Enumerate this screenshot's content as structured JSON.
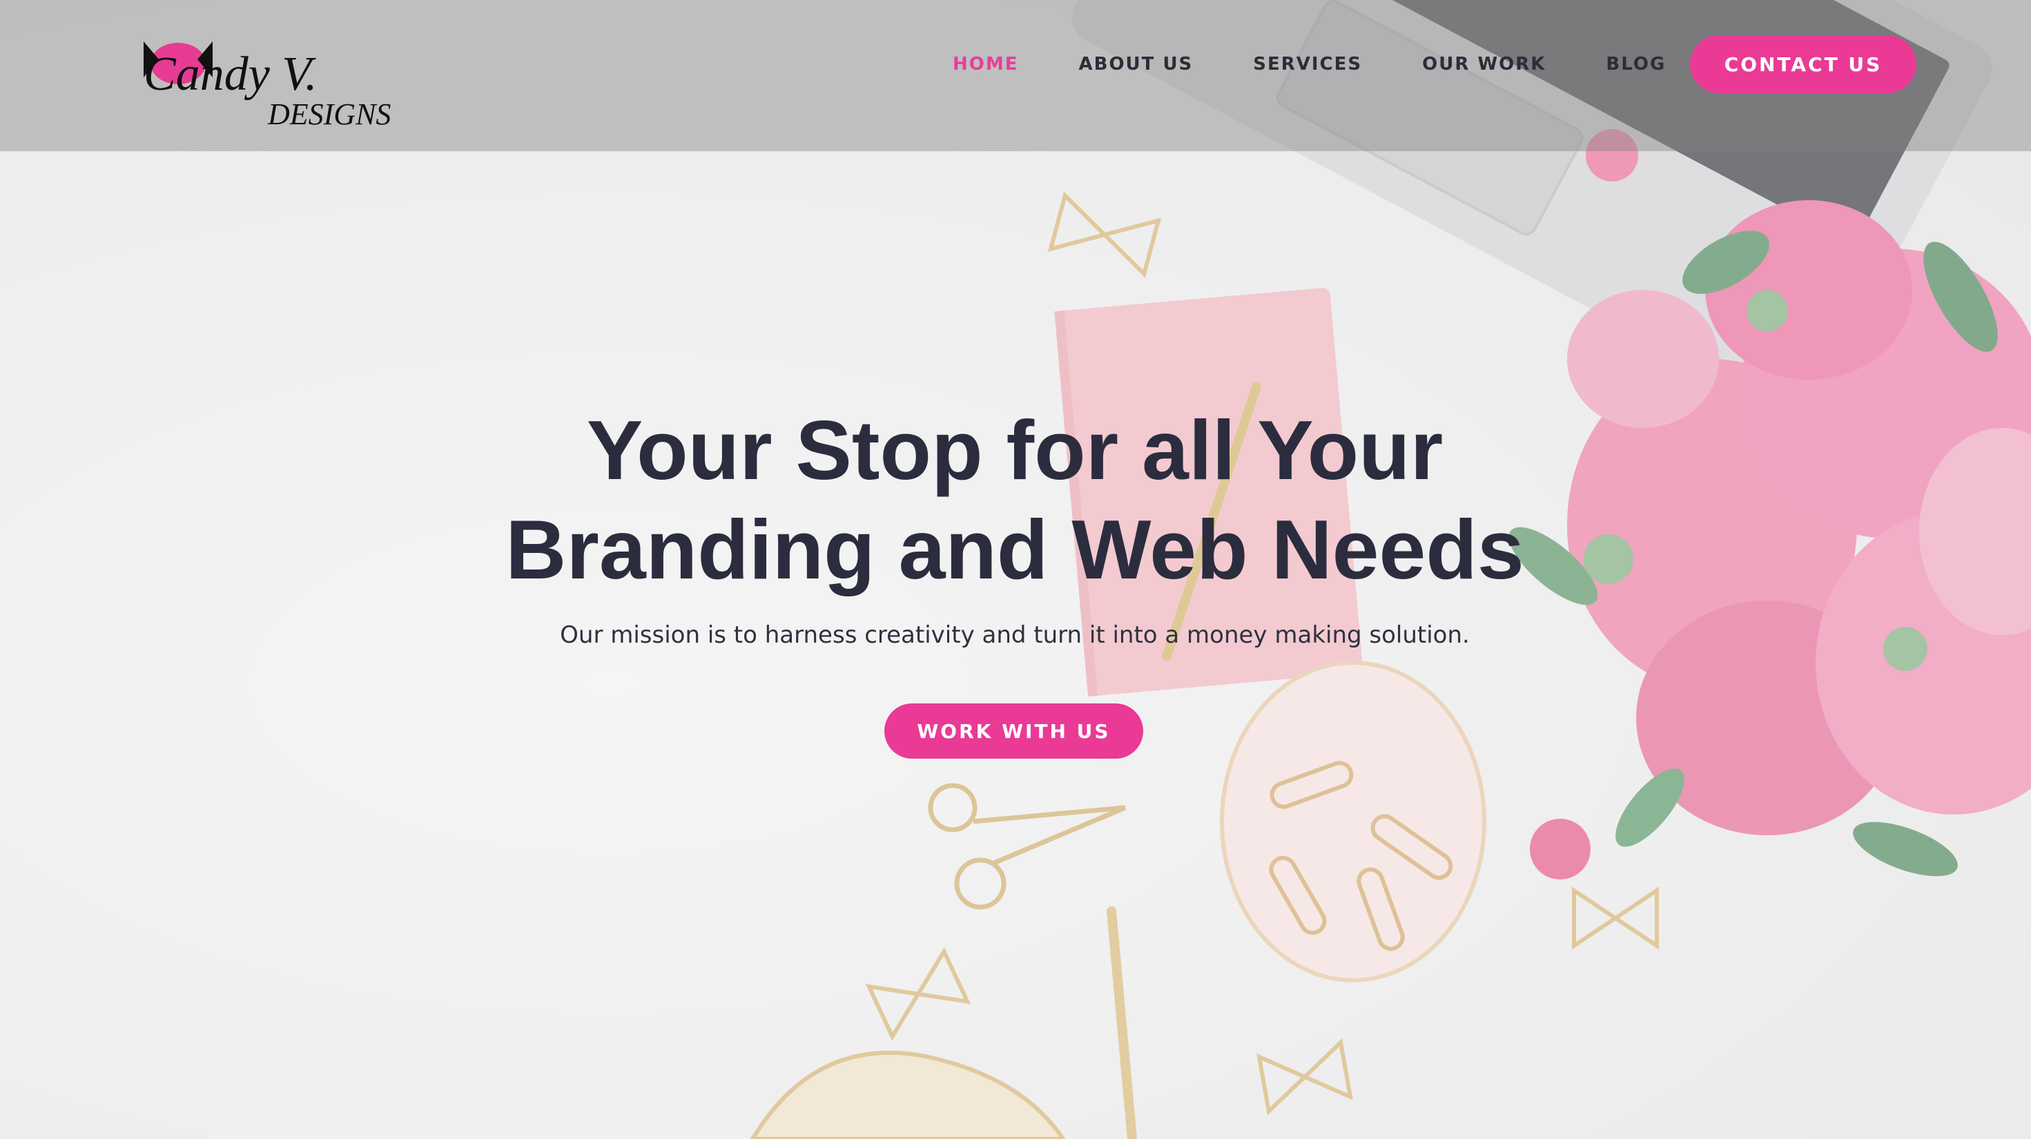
{
  "brand": {
    "logo_line1": "Candy V.",
    "logo_line2": "DESIGNS",
    "logo_alt": "Candy V. Designs logo"
  },
  "nav": {
    "items": [
      {
        "label": "HOME",
        "active": true
      },
      {
        "label": "ABOUT US",
        "active": false
      },
      {
        "label": "SERVICES",
        "active": false
      },
      {
        "label": "OUR WORK",
        "active": false
      },
      {
        "label": "BLOG",
        "active": false
      }
    ],
    "contact_label": "CONTACT US"
  },
  "hero": {
    "headline_line1": "Your Stop for all Your",
    "headline_line2": "Branding and Web Needs",
    "subheadline": "Our mission is to harness creativity and turn it into a money making solution.",
    "cta_label": "WORK WITH US",
    "background_description_icons": [
      "laptop-icon",
      "notebook-icon",
      "peony-bouquet-icon",
      "paper-clip-icon",
      "scissors-icon",
      "pen-icon"
    ]
  },
  "colors": {
    "accent": "#ea3a95",
    "heading": "#2b2d3e",
    "header_bar": "#8a8a8a"
  }
}
